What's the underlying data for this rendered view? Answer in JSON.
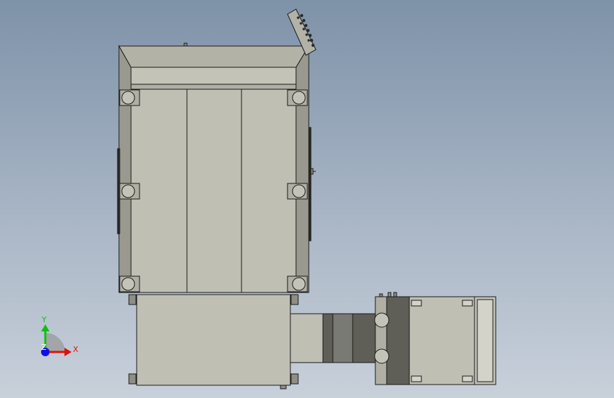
{
  "triad": {
    "x_label": "X",
    "y_label": "Y",
    "z_label": "Z",
    "x_color": "#e01010",
    "y_color": "#10c010",
    "z_color": "#1010e0"
  },
  "colors": {
    "body": "#c0bfb4",
    "body_dark": "#8f8e84",
    "body_mid": "#a8a79c",
    "outline": "#1a1a1a",
    "coupling_dark": "#5f5e57",
    "coupling_mid": "#7a7a74"
  }
}
